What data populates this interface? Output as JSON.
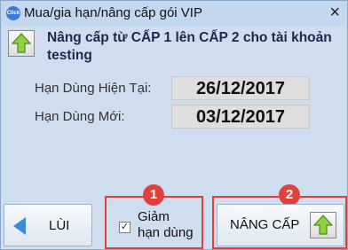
{
  "window": {
    "title": "Mua/gia hạn/nâng cấp gói VIP",
    "app_icon_text": "Click",
    "close_glyph": "×"
  },
  "header": {
    "text": "Nâng cấp từ CẤP 1 lên CẤP 2 cho tài khoản testing"
  },
  "fields": [
    {
      "label": "Hạn Dùng Hiện Tại:",
      "value": "26/12/2017"
    },
    {
      "label": "Hạn Dùng Mới:",
      "value": "03/12/2017"
    }
  ],
  "checkbox": {
    "label_line1": "Giảm",
    "label_line2": "hạn dùng",
    "checked": true,
    "check_glyph": "✓"
  },
  "buttons": {
    "back": "LÙI",
    "upgrade": "NÂNG CẤP"
  },
  "annotations": {
    "badge1": "1",
    "badge2": "2",
    "highlight_color": "#e0413d"
  },
  "icons": {
    "app": "app-logo-icon",
    "header": "green-up-arrow-icon",
    "back": "blue-left-arrow-icon",
    "upgrade": "green-up-arrow-icon"
  }
}
